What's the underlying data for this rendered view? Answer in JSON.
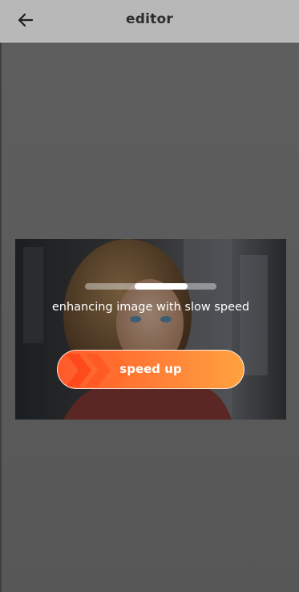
{
  "header": {
    "title": "editor",
    "back_icon": "arrow-left-icon"
  },
  "overlay": {
    "progress_fraction": 0.4,
    "status_text": "enhancing image with slow speed",
    "speed_button_label": "speed up",
    "speed_icon": "chevrons-right-icon"
  },
  "colors": {
    "header_bg": "#b8b8b8",
    "backdrop": "#5b5b5b",
    "button_gradient_start": "#ff5a2a",
    "button_gradient_end": "#ffa23f"
  }
}
